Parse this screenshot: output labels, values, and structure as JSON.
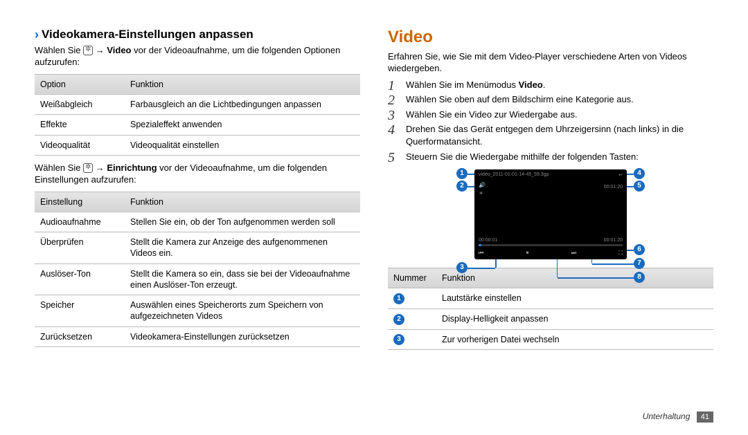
{
  "left": {
    "heading": "Videokamera-Einstellungen anpassen",
    "intro_a": "Wählen Sie ",
    "intro_b": " → ",
    "intro_bold": "Video",
    "intro_c": " vor der Videoaufnahme, um die folgenden Optionen aufzurufen:",
    "t1": {
      "h1": "Option",
      "h2": "Funktion",
      "rows": [
        {
          "a": "Weißabgleich",
          "b": "Farbausgleich an die Lichtbedingungen anpassen"
        },
        {
          "a": "Effekte",
          "b": "Spezialeffekt anwenden"
        },
        {
          "a": "Videoqualität",
          "b": "Videoqualität einstellen"
        }
      ]
    },
    "mid_a": "Wählen Sie ",
    "mid_b": " → ",
    "mid_bold": "Einrichtung",
    "mid_c": " vor der Videoaufnahme, um die folgenden Einstellungen aufzurufen:",
    "t2": {
      "h1": "Einstellung",
      "h2": "Funktion",
      "rows": [
        {
          "a": "Audioaufnahme",
          "b": "Stellen Sie ein, ob der Ton aufgenommen werden soll"
        },
        {
          "a": "Überprüfen",
          "b": "Stellt die Kamera zur Anzeige des aufgenommenen Videos ein."
        },
        {
          "a": "Auslöser-Ton",
          "b": "Stellt die Kamera so ein, dass sie bei der Videoaufnahme einen Auslöser-Ton erzeugt."
        },
        {
          "a": "Speicher",
          "b": "Auswählen eines Speicherorts zum Speichern von aufgezeichneten Videos"
        },
        {
          "a": "Zurücksetzen",
          "b": "Videokamera-Einstellungen zurücksetzen"
        }
      ]
    }
  },
  "right": {
    "heading": "Video",
    "intro": "Erfahren Sie, wie Sie mit dem Video-Player verschiedene Arten von Videos wiedergeben.",
    "steps": [
      {
        "pre": "Wählen Sie im Menümodus ",
        "bold": "Video",
        "post": "."
      },
      {
        "pre": "Wählen Sie oben auf dem Bildschirm eine Kategorie aus.",
        "bold": "",
        "post": ""
      },
      {
        "pre": "Wählen Sie ein Video zur Wiedergabe aus.",
        "bold": "",
        "post": ""
      },
      {
        "pre": "Drehen Sie das Gerät entgegen dem Uhrzeigersinn (nach links) in die Querformatansicht.",
        "bold": "",
        "post": ""
      },
      {
        "pre": "Steuern Sie die Wiedergabe mithilfe der folgenden Tasten:",
        "bold": "",
        "post": ""
      }
    ],
    "screen": {
      "filename": "video_2011-01-01-14-45_59.3gp",
      "time_cur": "00:00:01",
      "time_total": "00:01:20"
    },
    "callouts": [
      "1",
      "2",
      "3",
      "4",
      "5",
      "6",
      "7",
      "8"
    ],
    "t3": {
      "h1": "Nummer",
      "h2": "Funktion",
      "rows": [
        {
          "n": "1",
          "b": "Lautstärke einstellen"
        },
        {
          "n": "2",
          "b": "Display-Helligkeit anpassen"
        },
        {
          "n": "3",
          "b": "Zur vorherigen Datei wechseln"
        }
      ]
    }
  },
  "footer": {
    "section": "Unterhaltung",
    "page": "41"
  }
}
